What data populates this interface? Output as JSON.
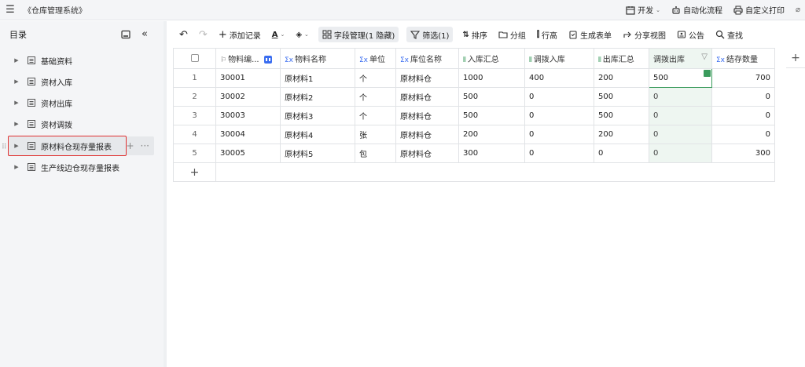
{
  "app": {
    "title": "《仓库管理系统》"
  },
  "topbar": {
    "dev_label": "开发",
    "automation_label": "自动化流程",
    "print_label": "自定义打印"
  },
  "sidebar": {
    "title": "目录",
    "items": [
      {
        "label": "基础资料"
      },
      {
        "label": "资材入库"
      },
      {
        "label": "资材出库"
      },
      {
        "label": "资材调拨"
      },
      {
        "label": "原材料仓现存量报表"
      },
      {
        "label": "生产线边仓现存量报表"
      }
    ]
  },
  "toolbar": {
    "add_record": "添加记录",
    "field_manage": "字段管理(1 隐藏)",
    "filter": "筛选(1)",
    "sort": "排序",
    "group": "分组",
    "row_height": "行高",
    "gen_form": "生成表单",
    "share_view": "分享视图",
    "notice": "公告",
    "search": "查找"
  },
  "table": {
    "headers": [
      "物料编...",
      "物料名称",
      "单位",
      "库位名称",
      "入库汇总",
      "调拨入库",
      "出库汇总",
      "调拨出库",
      "结存数量"
    ],
    "rows": [
      {
        "idx": "1",
        "code": "30001",
        "name": "原材料1",
        "unit": "个",
        "loc": "原材料仓",
        "in": "1000",
        "tin": "400",
        "out": "200",
        "tout": "500",
        "bal": "700"
      },
      {
        "idx": "2",
        "code": "30002",
        "name": "原材料2",
        "unit": "个",
        "loc": "原材料仓",
        "in": "500",
        "tin": "0",
        "out": "500",
        "tout": "0",
        "bal": "0"
      },
      {
        "idx": "3",
        "code": "30003",
        "name": "原材料3",
        "unit": "个",
        "loc": "原材料仓",
        "in": "500",
        "tin": "0",
        "out": "500",
        "tout": "0",
        "bal": "0"
      },
      {
        "idx": "4",
        "code": "30004",
        "name": "原材料4",
        "unit": "张",
        "loc": "原材料仓",
        "in": "200",
        "tin": "0",
        "out": "200",
        "tout": "0",
        "bal": "0"
      },
      {
        "idx": "5",
        "code": "30005",
        "name": "原材料5",
        "unit": "包",
        "loc": "原材料仓",
        "in": "300",
        "tin": "0",
        "out": "0",
        "tout": "0",
        "bal": "300"
      }
    ]
  },
  "colors": {
    "accent_green": "#3a9b5c",
    "accent_blue": "#3a6df0",
    "highlight": "#e03131"
  }
}
